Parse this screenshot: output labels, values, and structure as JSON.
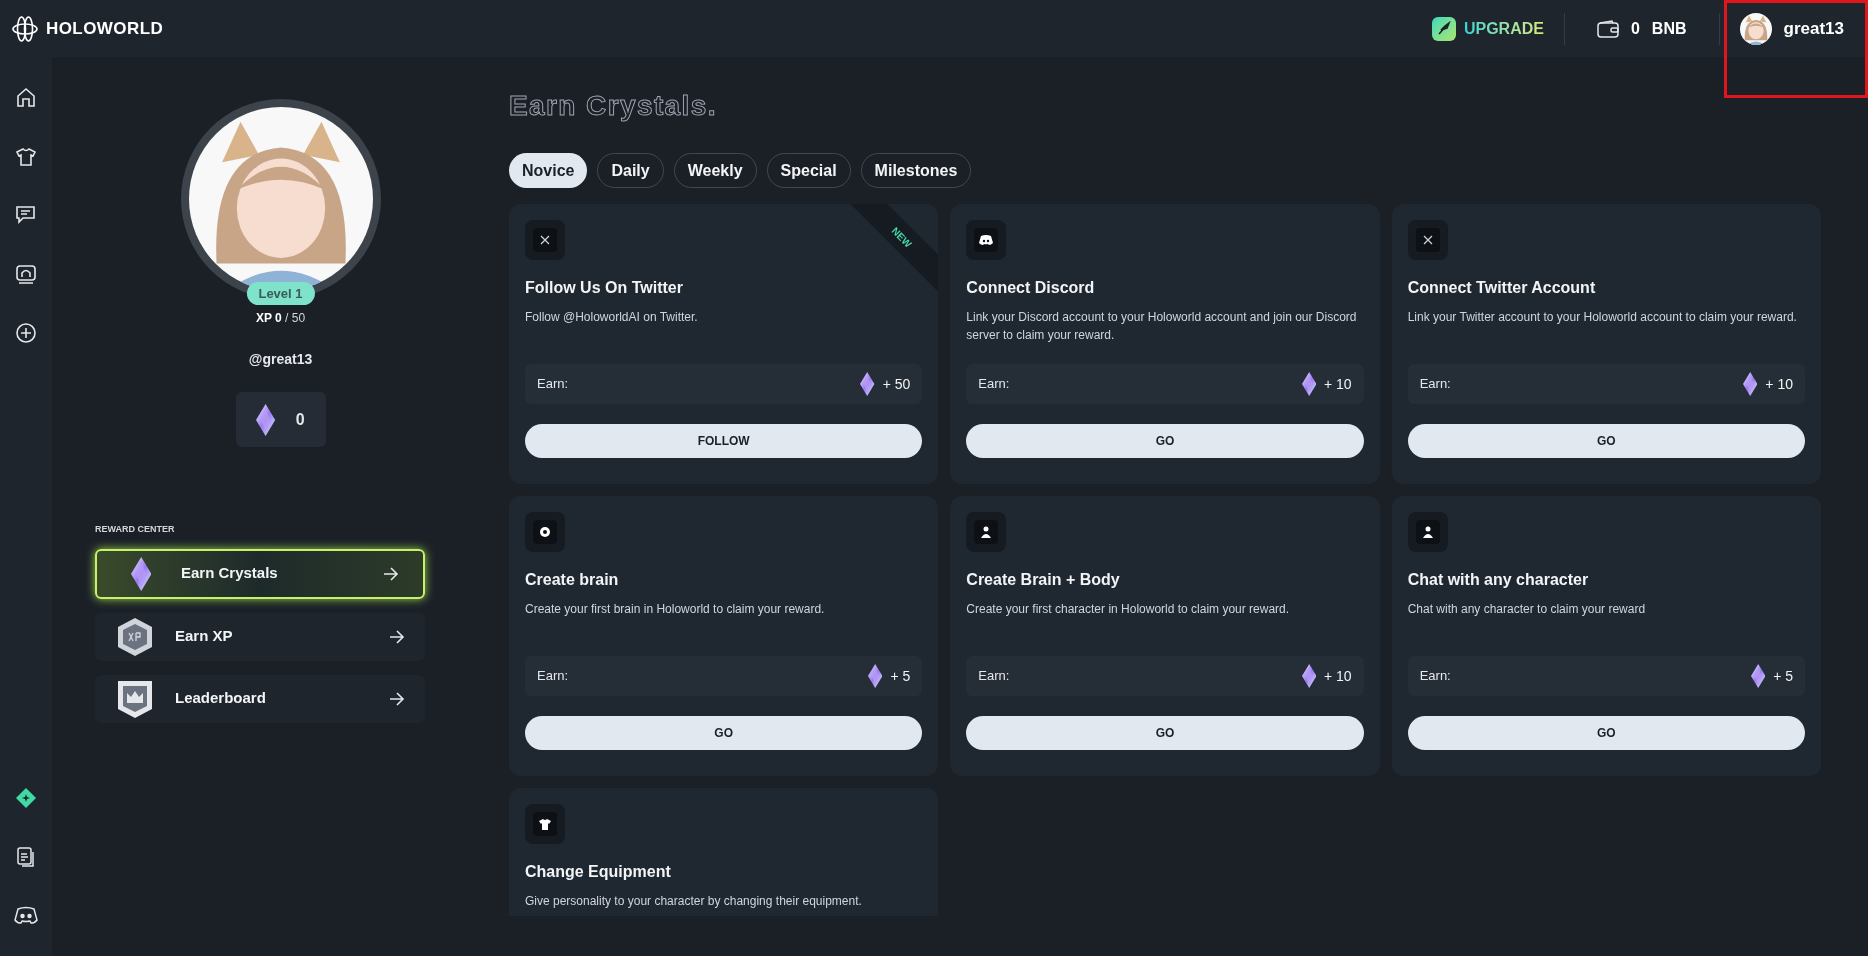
{
  "brand": {
    "name": "HOLOWORLD"
  },
  "topbar": {
    "upgrade": "UPGRADE",
    "balance": "0",
    "currency": "BNB",
    "username": "great13"
  },
  "profile": {
    "level": "Level 1",
    "xp_label": "XP",
    "xp_current": "0",
    "xp_total": "/ 50",
    "handle": "@great13",
    "crystals": "0"
  },
  "reward_center": {
    "title": "REWARD CENTER",
    "items": [
      {
        "label": "Earn Crystals",
        "kind": "crystal",
        "selected": true
      },
      {
        "label": "Earn XP",
        "kind": "xp",
        "selected": false
      },
      {
        "label": "Leaderboard",
        "kind": "crown",
        "selected": false
      }
    ]
  },
  "page_title": "Earn Crystals.",
  "tabs": [
    {
      "label": "Novice",
      "selected": true
    },
    {
      "label": "Daily",
      "selected": false
    },
    {
      "label": "Weekly",
      "selected": false
    },
    {
      "label": "Special",
      "selected": false
    },
    {
      "label": "Milestones",
      "selected": false
    }
  ],
  "tasks": [
    {
      "kind": "x",
      "ribbon": "NEW",
      "title": "Follow Us On Twitter",
      "description": "Follow @HoloworldAI on Twitter.",
      "earn_label": "Earn:",
      "reward": "+ 50",
      "action": "FOLLOW"
    },
    {
      "kind": "discord",
      "title": "Connect Discord",
      "description": "Link your Discord account to your Holoworld account and join our Discord server to claim your reward.",
      "earn_label": "Earn:",
      "reward": "+ 10",
      "action": "GO"
    },
    {
      "kind": "x",
      "title": "Connect Twitter Account",
      "description": "Link your Twitter account to your Holoworld account to claim your reward.",
      "earn_label": "Earn:",
      "reward": "+ 10",
      "action": "GO"
    },
    {
      "kind": "brain",
      "title": "Create brain",
      "description": "Create your first brain in Holoworld to claim your reward.",
      "earn_label": "Earn:",
      "reward": "+ 5",
      "action": "GO"
    },
    {
      "kind": "person",
      "title": "Create Brain + Body",
      "description": "Create your first character in Holoworld to claim your reward.",
      "earn_label": "Earn:",
      "reward": "+ 10",
      "action": "GO"
    },
    {
      "kind": "person",
      "title": "Chat with any character",
      "description": "Chat with any character to claim your reward",
      "earn_label": "Earn:",
      "reward": "+ 5",
      "action": "GO"
    },
    {
      "kind": "equipment",
      "title": "Change Equipment",
      "description": "Give personality to your character by changing their equipment."
    }
  ]
}
